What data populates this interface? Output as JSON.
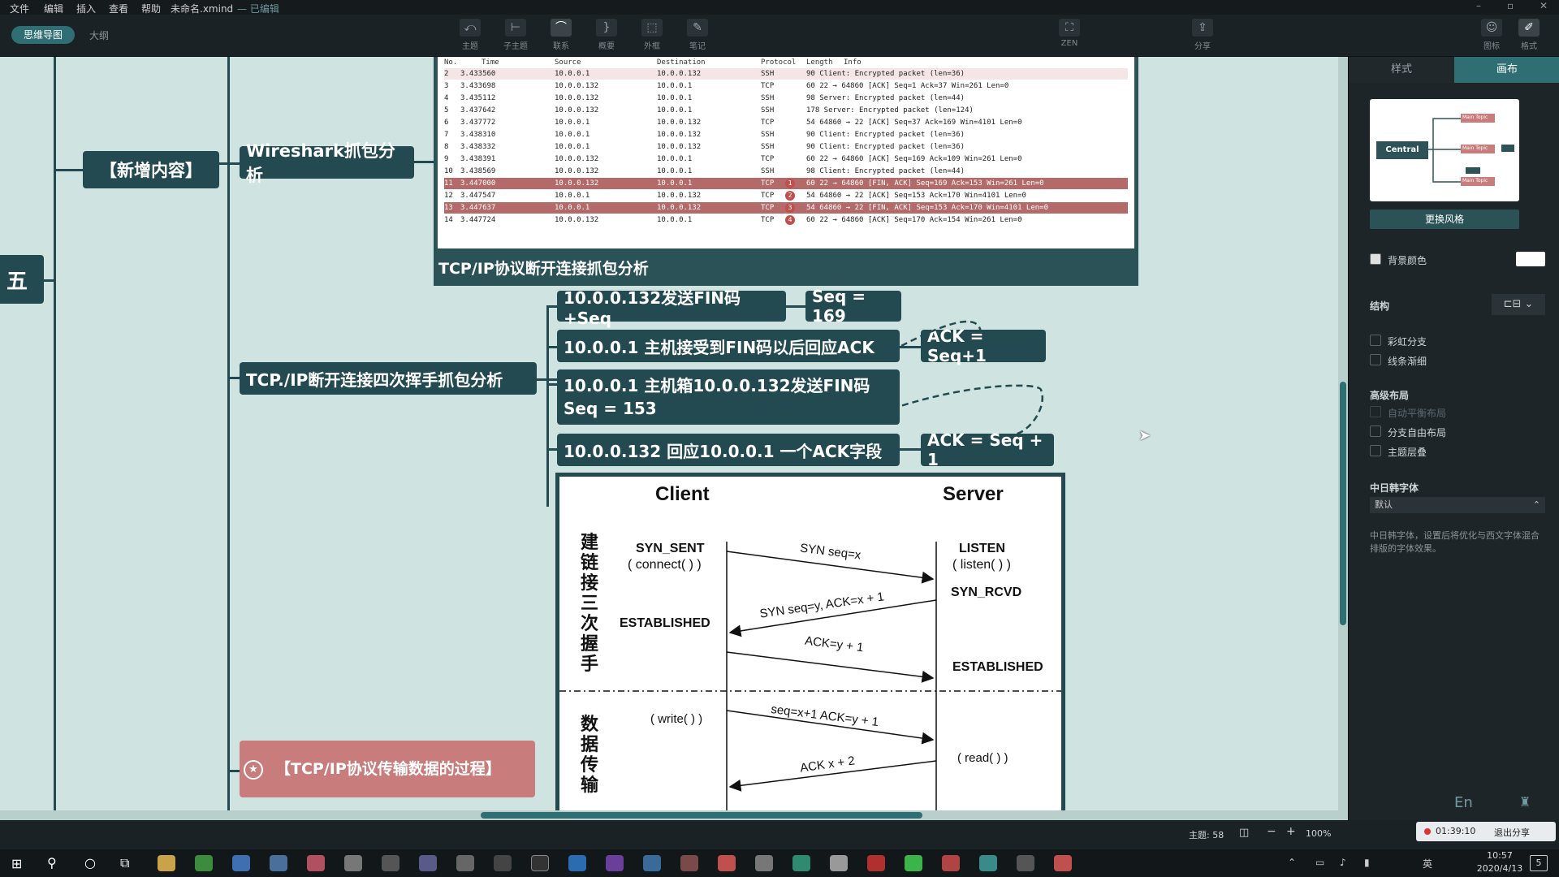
{
  "menubar": {
    "items": [
      "文件",
      "编辑",
      "插入",
      "查看",
      "帮助"
    ],
    "file_title": "未命名.xmind",
    "edit_state": "— 已编辑"
  },
  "toolbar": {
    "view_tabs": [
      "思维导图",
      "大纲"
    ],
    "tools": [
      "主题",
      "子主题",
      "联系",
      "概要",
      "外框",
      "笔记"
    ],
    "zen": "ZEN",
    "share": "分享",
    "icon_label": "图标",
    "format_label": "格式"
  },
  "mindmap": {
    "partial_topic": "五",
    "new_content": "【新增内容】",
    "wireshark_topic": "Wireshark抓包分析",
    "capture_caption": "TCP/IP协议断开连接抓包分析",
    "four_way_topic": "TCP./IP断开连接四次挥手抓包分析",
    "step1": "10.0.0.132发送FIN码+Seq",
    "step1_value": "Seq = 169",
    "step2": "10.0.0.1 主机接受到FIN码以后回应ACK",
    "step2_value": "ACK = Seq+1",
    "step3_line1": "10.0.0.1 主机箱10.0.0.132发送FIN码",
    "step3_line2": "Seq = 153",
    "step4": "10.0.0.132 回应10.0.0.1 一个ACK字段",
    "step4_value": "ACK = Seq + 1",
    "transfer_topic": "【TCP/IP协议传输数据的过程】"
  },
  "capture": {
    "headers": [
      "No.",
      "Time",
      "Source",
      "Destination",
      "Protocol",
      "Length",
      "Info"
    ],
    "rows": [
      {
        "no": "2",
        "time": "3.433560",
        "src": "10.0.0.1",
        "dst": "10.0.0.132",
        "proto": "SSH",
        "info": "90 Client: Encrypted packet (len=36)",
        "hl": false
      },
      {
        "no": "3",
        "time": "3.433698",
        "src": "10.0.0.132",
        "dst": "10.0.0.1",
        "proto": "TCP",
        "info": "60 22 → 64860 [ACK] Seq=1 Ack=37 Win=261 Len=0",
        "hl": false
      },
      {
        "no": "4",
        "time": "3.435112",
        "src": "10.0.0.132",
        "dst": "10.0.0.1",
        "proto": "SSH",
        "info": "98 Server: Encrypted packet (len=44)",
        "hl": false
      },
      {
        "no": "5",
        "time": "3.437642",
        "src": "10.0.0.132",
        "dst": "10.0.0.1",
        "proto": "SSH",
        "info": "178 Server: Encrypted packet (len=124)",
        "hl": false
      },
      {
        "no": "6",
        "time": "3.437772",
        "src": "10.0.0.1",
        "dst": "10.0.0.132",
        "proto": "TCP",
        "info": "54 64860 → 22 [ACK] Seq=37 Ack=169 Win=4101 Len=0",
        "hl": false
      },
      {
        "no": "7",
        "time": "3.438310",
        "src": "10.0.0.1",
        "dst": "10.0.0.132",
        "proto": "SSH",
        "info": "90 Client: Encrypted packet (len=36)",
        "hl": false
      },
      {
        "no": "8",
        "time": "3.438332",
        "src": "10.0.0.1",
        "dst": "10.0.0.132",
        "proto": "SSH",
        "info": "90 Client: Encrypted packet (len=36)",
        "hl": false
      },
      {
        "no": "9",
        "time": "3.438391",
        "src": "10.0.0.132",
        "dst": "10.0.0.1",
        "proto": "TCP",
        "info": "60 22 → 64860 [ACK] Seq=169 Ack=109 Win=261 Len=0",
        "hl": false
      },
      {
        "no": "10",
        "time": "3.438569",
        "src": "10.0.0.132",
        "dst": "10.0.0.1",
        "proto": "SSH",
        "info": "98 Client: Encrypted packet (len=44)",
        "hl": false
      },
      {
        "no": "11",
        "time": "3.447000",
        "src": "10.0.0.132",
        "dst": "10.0.0.1",
        "proto": "TCP",
        "info": "60 22 → 64860 [FIN, ACK] Seq=169 Ack=153 Win=261 Len=0",
        "hl": true,
        "badge": "1"
      },
      {
        "no": "12",
        "time": "3.447547",
        "src": "10.0.0.1",
        "dst": "10.0.0.132",
        "proto": "TCP",
        "info": "54 64860 → 22 [ACK] Seq=153 Ack=170 Win=4101 Len=0",
        "hl": false,
        "badge": "2"
      },
      {
        "no": "13",
        "time": "3.447637",
        "src": "10.0.0.1",
        "dst": "10.0.0.132",
        "proto": "TCP",
        "info": "54 64860 → 22 [FIN, ACK] Seq=153 Ack=170 Win=4101 Len=0",
        "hl": true,
        "badge": "3"
      },
      {
        "no": "14",
        "time": "3.447724",
        "src": "10.0.0.132",
        "dst": "10.0.0.1",
        "proto": "TCP",
        "info": "60 22 → 64860 [ACK] Seq=170 Ack=154 Win=261 Len=0",
        "hl": false,
        "badge": "4"
      }
    ]
  },
  "diagram": {
    "client": "Client",
    "server": "Server",
    "handshake_label": "建链接三次握手",
    "transfer_label": "数据传输",
    "syn_sent": "SYN_SENT",
    "connect": "( connect( ) )",
    "listen": "LISTEN",
    "listen_call": "( listen( ) )",
    "syn_rcvd": "SYN_RCVD",
    "established_client": "ESTABLISHED",
    "established_server": "ESTABLISHED",
    "msg1": "SYN seq=x",
    "msg2": "SYN seq=y, ACK=x + 1",
    "msg3": "ACK=y + 1",
    "write": "( write( ) )",
    "read": "( read( ) )",
    "msg4": "seq=x+1 ACK=y + 1",
    "msg5": "ACK x + 2"
  },
  "rightpanel": {
    "tabs": [
      "样式",
      "画布"
    ],
    "preview_central": "Central topic",
    "preview_main": "Main Topic",
    "change_style": "更换风格",
    "bg_color": "背景颜色",
    "structure": "结构",
    "rainbow": "彩虹分支",
    "taper": "线条渐细",
    "advanced": "高级布局",
    "auto_balance": "自动平衡布局",
    "free_layout": "分支自由布局",
    "overlap": "主题层叠",
    "cjk_font": "中日韩字体",
    "cjk_default": "默认",
    "cjk_desc": "中日韩字体，设置后将优化与西文字体混合排版的字体效果。",
    "ime": "En",
    "timer": "01:39:10",
    "exit_share": "退出分享"
  },
  "statusbar": {
    "topics": "主题: 58",
    "zoom": "100%"
  },
  "taskbar": {
    "time": "10:57",
    "date": "2020/4/13",
    "lang": "英",
    "notif": "5"
  }
}
